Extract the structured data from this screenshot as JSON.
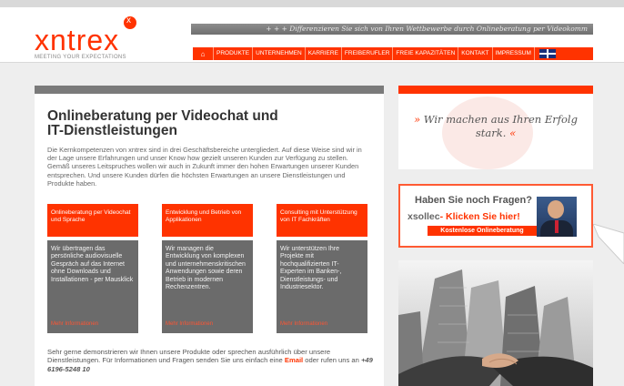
{
  "header": {
    "logo_text": "xntrex",
    "tagline": "MEETING YOUR EXPECTATIONS",
    "ticker": "+ + + Differenzieren Sie sich von Ihren Wettbewerbe durch Onlineberatung per Videokomm",
    "nav_items": [
      "PRODUKTE",
      "UNTERNEHMEN",
      "KARRIERE",
      "FREIBERUFLER",
      "FREIE KAPAZITÄTEN",
      "KONTAKT",
      "IMPRESSUM"
    ],
    "home_icon": "home-icon",
    "flag_icon": "uk-flag-icon"
  },
  "main": {
    "title_line1": "Onlineberatung per Videochat und",
    "title_line2": "IT-Dienstleistungen",
    "intro": "Die Kernkompetenzen von xntrex sind in drei Geschäftsbereiche untergliedert. Auf diese Weise sind wir in der Lage unsere Erfahrungen und unser Know how gezielt unseren Kunden zur Verfügung zu stellen. Gemäß unseres Leitspruches wollen wir auch in Zukunft immer den hohen Erwartungen unserer Kunden entsprechen. Und unsere Kunden dürfen die höchsten Erwartungen an unsere Dienstleistungen und Produkte haben.",
    "columns": [
      {
        "head": "Onlineberatung per Videochat und Sprache",
        "body": "Wir übertragen das persönliche audiovisuelle Gespräch auf das Internet ohne Downloads und Installationen - per Mausklick",
        "more": "Mehr Informationen"
      },
      {
        "head": "Entwicklung und Betrieb von Applikationen",
        "body": "Wir managen die Entwicklung von komplexen und unternehmenskritischen Anwendungen sowie deren Betrieb in modernen Rechenzentren.",
        "more": "Mehr Informationen"
      },
      {
        "head": "Consulting mit Unterstützung von IT Fachkräften",
        "body": "Wir unterstützen Ihre Projekte mit hochqualifizierten IT-Experten im Banken-, Dienstleistungs- und Industriesektor.",
        "more": "Mehr Informationen"
      }
    ],
    "footer_part1": "Sehr gerne demonstrieren wir Ihnen unsere Produkte oder sprechen ausführlich über unsere Dienstleistungen. Für Informationen und Fragen senden Sie uns einfach eine",
    "footer_email": "Email",
    "footer_part2": "oder rufen uns an",
    "footer_phone": "+49 6196-5248 10"
  },
  "sidebar": {
    "quote_open": "»",
    "quote_text": "Wir machen aus Ihren Erfolg stark.",
    "quote_close": "«",
    "questions_line1": "Haben Sie noch Fragen?",
    "questions_brand": "xsollec",
    "questions_cta": "- Klicken Sie hier!",
    "consult_button": "Kostenlose Onlineberatung"
  },
  "colors": {
    "accent": "#ff3300",
    "dark_box": "#6b6b6b",
    "header_bar": "#7a7a7a"
  }
}
